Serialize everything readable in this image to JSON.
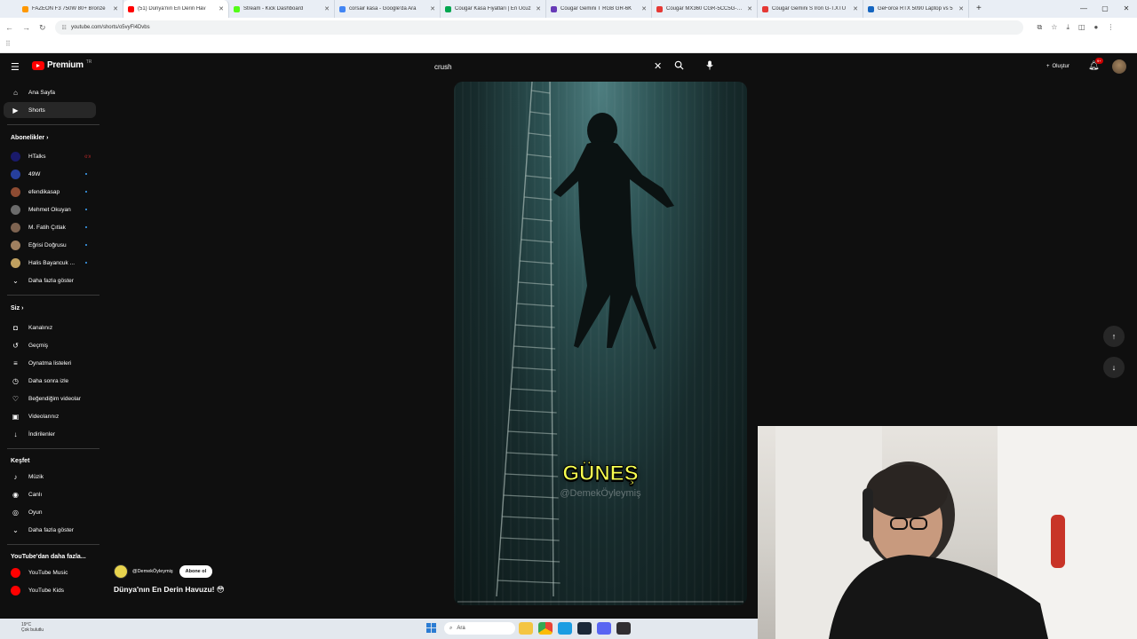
{
  "browser": {
    "tabs": [
      {
        "title": "FAZEON F3 750W 80+ Bronze",
        "color": "#ff9800",
        "active": false
      },
      {
        "title": "(51) Dünya'nın En Derin Hav",
        "color": "#ff0000",
        "active": true
      },
      {
        "title": "Stream - Kick Dashboard",
        "color": "#53fc18",
        "active": false
      },
      {
        "title": "corsair kasa - Google'da Ara",
        "color": "#4285f4",
        "active": false
      },
      {
        "title": "Cougar Kasa Fiyatları | En Ucuz",
        "color": "#00a650",
        "active": false
      },
      {
        "title": "Cougar Gemini T RGB GR-6K",
        "color": "#673ab7",
        "active": false
      },
      {
        "title": "Cougar MX360 CGR-5CC5G-RG",
        "color": "#e53935",
        "active": false
      },
      {
        "title": "Cougar Gemini S Iron G-T.XTU",
        "color": "#e53935",
        "active": false
      },
      {
        "title": "GeForce RTX 5090 Laptop vs 5",
        "color": "#1565c0",
        "active": false
      }
    ],
    "url": "youtube.com/shorts/o5vyFl4Dvbs"
  },
  "header": {
    "brand": "Premium",
    "brand_sup": "TR",
    "search_value": "crush",
    "create_label": "Oluştur",
    "notif_count": "9+"
  },
  "sidebar": {
    "top": [
      {
        "label": "Ana Sayfa",
        "icon": "⌂"
      },
      {
        "label": "Shorts",
        "icon": "▶"
      }
    ],
    "subs_heading": "Abonelikler",
    "subs": [
      {
        "label": "HTalks",
        "color": "#1a1a6a"
      },
      {
        "label": "49W",
        "color": "#263f9d"
      },
      {
        "label": "efendikasap",
        "color": "#8d4b32"
      },
      {
        "label": "Mehmet Okuyan",
        "color": "#6b6b6b"
      },
      {
        "label": "M. Fatih Çıtlak",
        "color": "#7d6350"
      },
      {
        "label": "Eğrisi Doğrusu",
        "color": "#a08060"
      },
      {
        "label": "Halis Bayancuk ...",
        "color": "#c0a060"
      }
    ],
    "subs_more": "Daha fazla göster",
    "you_heading": "Siz",
    "you": [
      {
        "label": "Kanalınız",
        "icon": "◘"
      },
      {
        "label": "Geçmiş",
        "icon": "↺"
      },
      {
        "label": "Oynatma listeleri",
        "icon": "≡"
      },
      {
        "label": "Daha sonra izle",
        "icon": "◷"
      },
      {
        "label": "Beğendiğim videolar",
        "icon": "♡"
      },
      {
        "label": "Videolarınız",
        "icon": "▣"
      },
      {
        "label": "İndirilenler",
        "icon": "↓"
      }
    ],
    "explore_heading": "Keşfet",
    "explore": [
      {
        "label": "Müzik",
        "icon": "♪"
      },
      {
        "label": "Canlı",
        "icon": "◉"
      },
      {
        "label": "Oyun",
        "icon": "◎"
      }
    ],
    "explore_more": "Daha fazla göster",
    "more_yt_heading": "YouTube'dan daha fazla...",
    "more_yt": [
      {
        "label": "YouTube Music",
        "color": "#ff0000"
      },
      {
        "label": "YouTube Kids",
        "color": "#ff0000"
      }
    ]
  },
  "video": {
    "caption": "GÜNEŞ",
    "watermark": "@DemekÖyleymiş",
    "channel_handle": "@DemekÖyleymiş",
    "subscribe_label": "Abone ol",
    "title": "Dünya'nın En Derin Havuzu! 😳",
    "progress": 0.0
  },
  "taskbar": {
    "weather_temp": "19°C",
    "weather_desc": "Çok bulutlu",
    "search_label": "Ara"
  }
}
